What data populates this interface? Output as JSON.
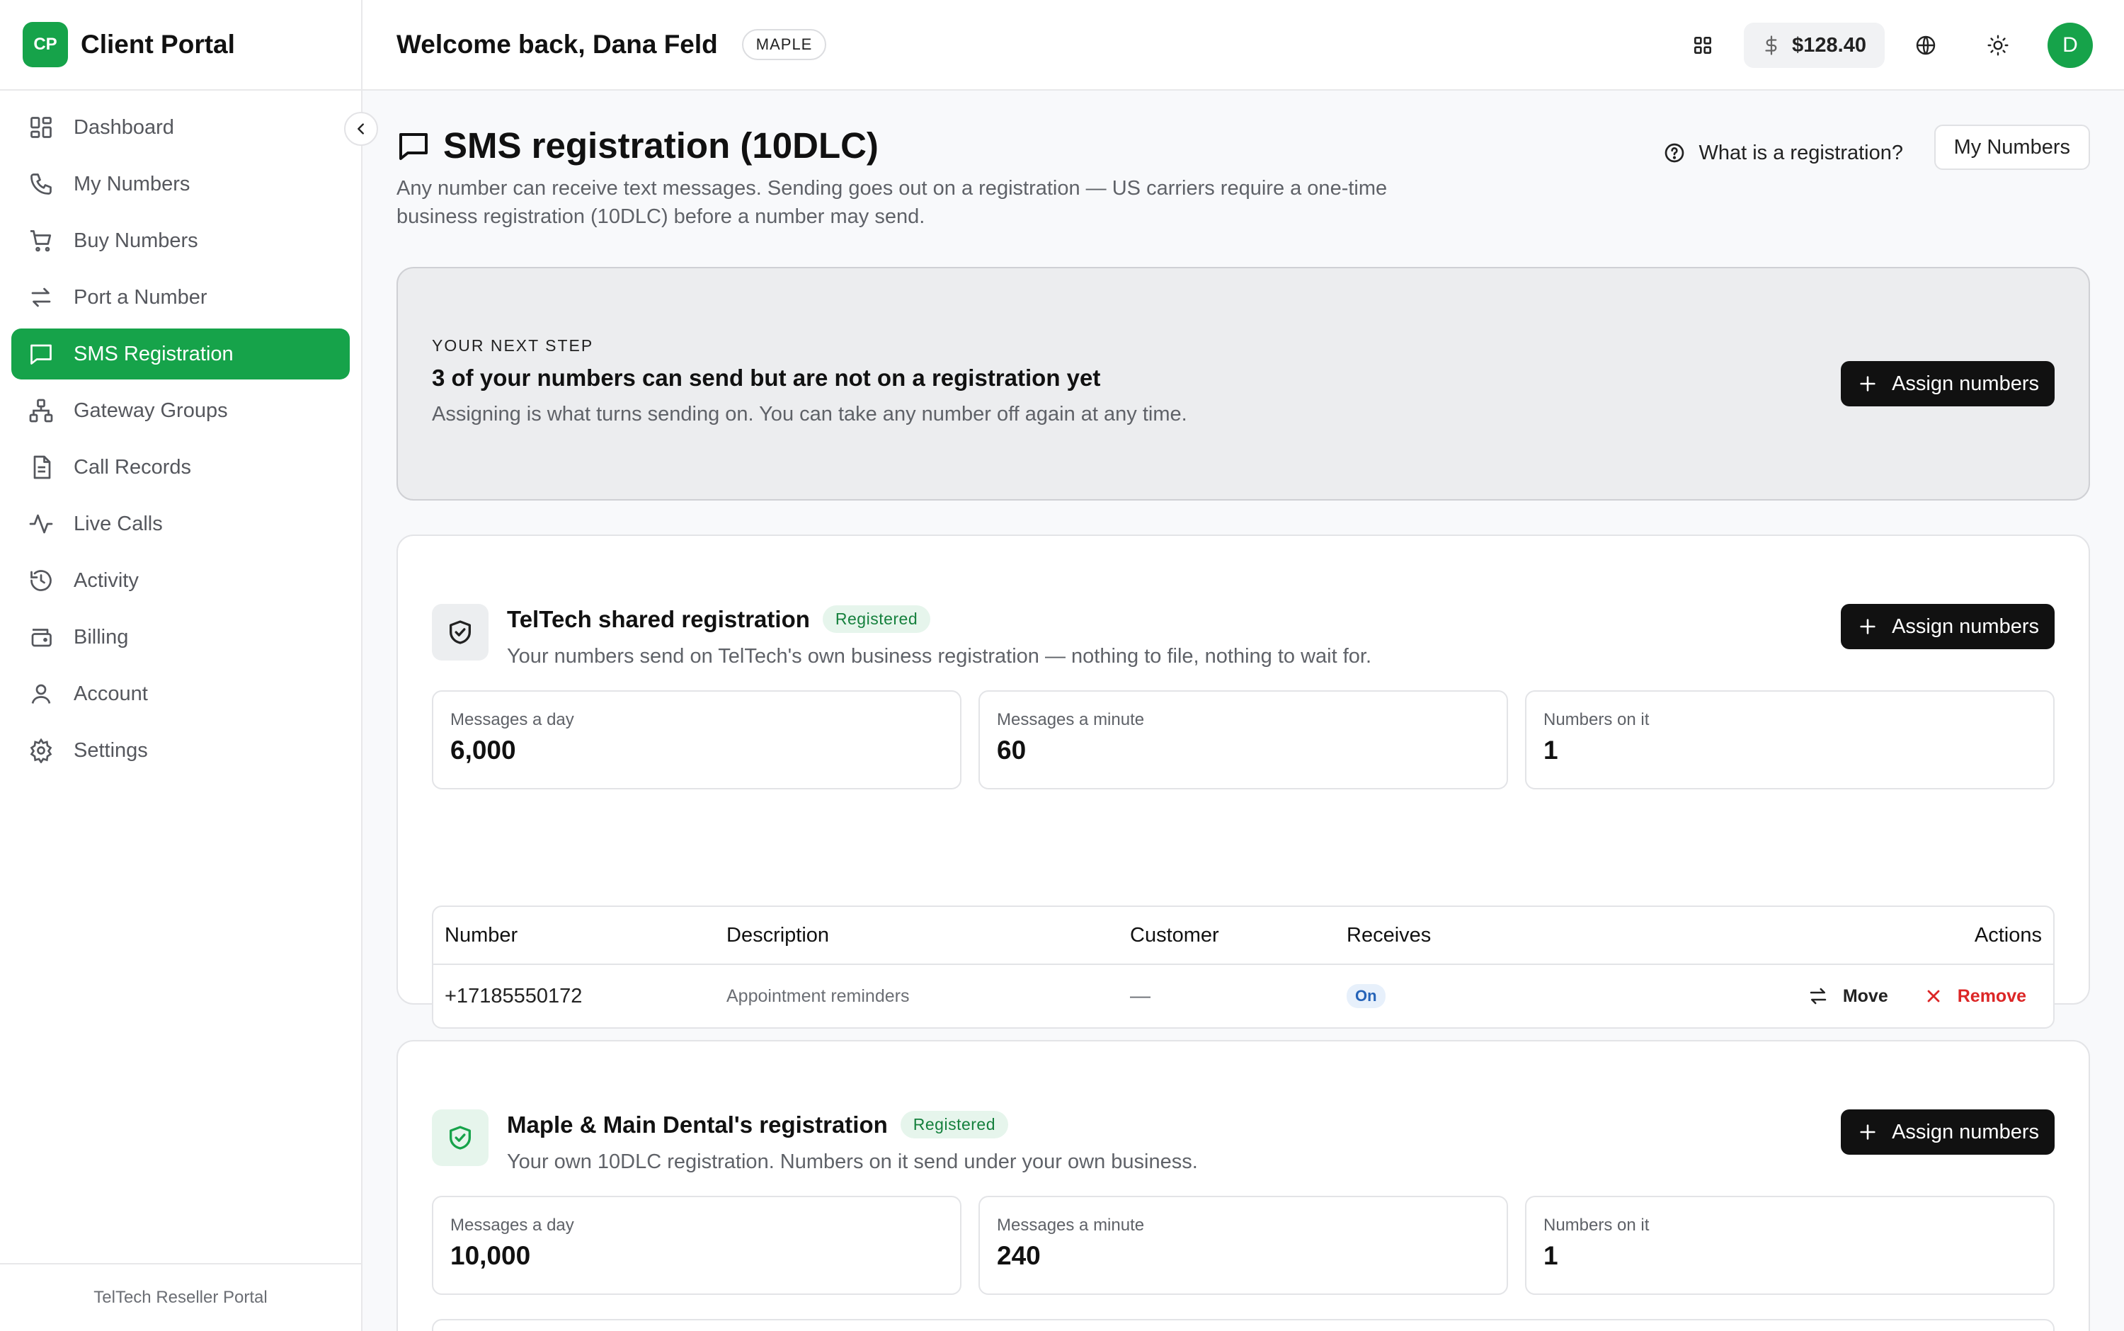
{
  "brand": {
    "logo_text": "CP",
    "name": "Client Portal"
  },
  "sidebar": {
    "items": [
      {
        "label": "Dashboard",
        "icon": "dashboard-icon"
      },
      {
        "label": "My Numbers",
        "icon": "phone-icon"
      },
      {
        "label": "Buy Numbers",
        "icon": "cart-icon"
      },
      {
        "label": "Port a Number",
        "icon": "transfer-icon"
      },
      {
        "label": "SMS Registration",
        "icon": "message-icon",
        "active": true
      },
      {
        "label": "Gateway Groups",
        "icon": "network-icon"
      },
      {
        "label": "Call Records",
        "icon": "document-icon"
      },
      {
        "label": "Live Calls",
        "icon": "activity-icon"
      },
      {
        "label": "Activity",
        "icon": "history-icon"
      },
      {
        "label": "Billing",
        "icon": "wallet-icon"
      },
      {
        "label": "Account",
        "icon": "user-icon"
      },
      {
        "label": "Settings",
        "icon": "gear-icon"
      }
    ],
    "footer": "TelTech Reseller Portal"
  },
  "header": {
    "welcome": "Welcome back, Dana Feld",
    "tenant": "MAPLE",
    "balance": "$128.40",
    "avatar_initial": "D"
  },
  "page": {
    "title": "SMS registration (10DLC)",
    "subtitle": "Any number can receive text messages. Sending goes out on a registration — US carriers require a one-time business registration (10DLC) before a number may send.",
    "help_link": "What is a registration?",
    "my_numbers_button": "My Numbers"
  },
  "next_step": {
    "label": "YOUR NEXT STEP",
    "title": "3 of your numbers can send but are not on a registration yet",
    "description": "Assigning is what turns sending on. You can take any number off again at any time.",
    "button": "Assign numbers"
  },
  "registrations": [
    {
      "title": "TelTech shared registration",
      "badge": "Registered",
      "description": "Your numbers send on TelTech's own business registration — nothing to file, nothing to wait for.",
      "button": "Assign numbers",
      "stats": [
        {
          "label": "Messages a day",
          "value": "6,000"
        },
        {
          "label": "Messages a minute",
          "value": "60"
        },
        {
          "label": "Numbers on it",
          "value": "1"
        }
      ],
      "table": {
        "headers": [
          "Number",
          "Description",
          "Customer",
          "Receives",
          "Actions"
        ],
        "rows": [
          {
            "number": "+17185550172",
            "description": "Appointment reminders",
            "customer": "—",
            "receives": "On",
            "move": "Move",
            "remove": "Remove"
          }
        ]
      }
    },
    {
      "title": "Maple & Main Dental's registration",
      "badge": "Registered",
      "description": "Your own 10DLC registration. Numbers on it send under your own business.",
      "button": "Assign numbers",
      "stats": [
        {
          "label": "Messages a day",
          "value": "10,000"
        },
        {
          "label": "Messages a minute",
          "value": "240"
        },
        {
          "label": "Numbers on it",
          "value": "1"
        }
      ]
    }
  ]
}
